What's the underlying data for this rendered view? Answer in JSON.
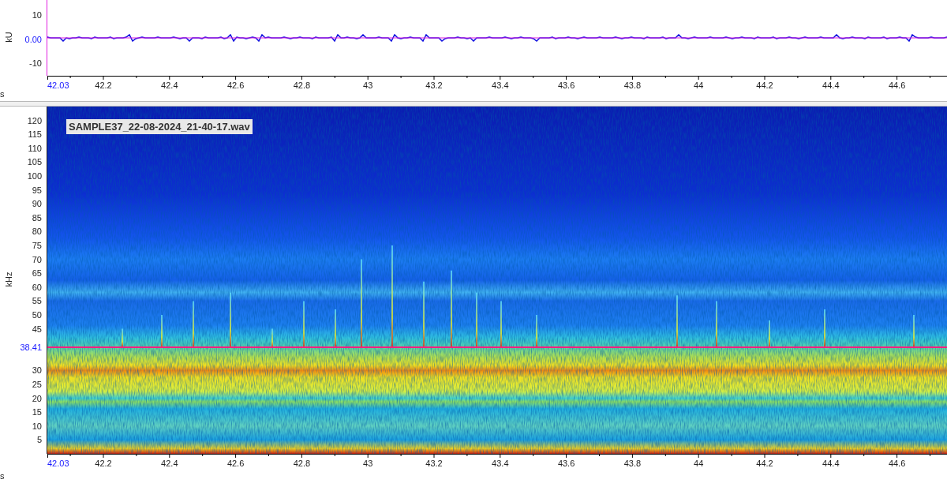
{
  "waveform": {
    "y_axis_label": "kU",
    "y_ticks": [
      {
        "label": "10",
        "highlighted": false
      },
      {
        "label": "0.00",
        "highlighted": true
      },
      {
        "label": "-10",
        "highlighted": false
      }
    ],
    "x_ticks": [
      {
        "label": "42.03",
        "highlighted": true
      },
      {
        "label": "42.2",
        "highlighted": false
      },
      {
        "label": "42.4",
        "highlighted": false
      },
      {
        "label": "42.6",
        "highlighted": false
      },
      {
        "label": "42.8",
        "highlighted": false
      },
      {
        "label": "43",
        "highlighted": false
      },
      {
        "label": "43.2",
        "highlighted": false
      },
      {
        "label": "43.4",
        "highlighted": false
      },
      {
        "label": "43.6",
        "highlighted": false
      },
      {
        "label": "43.8",
        "highlighted": false
      },
      {
        "label": "44",
        "highlighted": false
      },
      {
        "label": "44.2",
        "highlighted": false
      },
      {
        "label": "44.4",
        "highlighted": false
      },
      {
        "label": "44.6",
        "highlighted": false
      }
    ],
    "x_axis_label": "s"
  },
  "spectrogram": {
    "file_label": "SAMPLE37_22-08-2024_21-40-17.wav",
    "y_axis_label": "kHz",
    "upper_y_ticks": [
      "120",
      "115",
      "110",
      "105",
      "100",
      "95",
      "90",
      "85",
      "80",
      "75",
      "70",
      "65",
      "60",
      "55",
      "50",
      "45"
    ],
    "cursor": {
      "label": "38.41"
    },
    "lower_y_ticks": [
      "30",
      "25",
      "20",
      "15",
      "10",
      "5"
    ],
    "x_ticks": [
      {
        "label": "42.03",
        "highlighted": true
      },
      {
        "label": "42.2",
        "highlighted": false
      },
      {
        "label": "42.4",
        "highlighted": false
      },
      {
        "label": "42.6",
        "highlighted": false
      },
      {
        "label": "42.8",
        "highlighted": false
      },
      {
        "label": "43",
        "highlighted": false
      },
      {
        "label": "43.2",
        "highlighted": false
      },
      {
        "label": "43.4",
        "highlighted": false
      },
      {
        "label": "43.6",
        "highlighted": false
      },
      {
        "label": "43.8",
        "highlighted": false
      },
      {
        "label": "44",
        "highlighted": false
      },
      {
        "label": "44.2",
        "highlighted": false
      },
      {
        "label": "44.4",
        "highlighted": false
      },
      {
        "label": "44.6",
        "highlighted": false
      }
    ],
    "x_axis_label": "s"
  }
}
